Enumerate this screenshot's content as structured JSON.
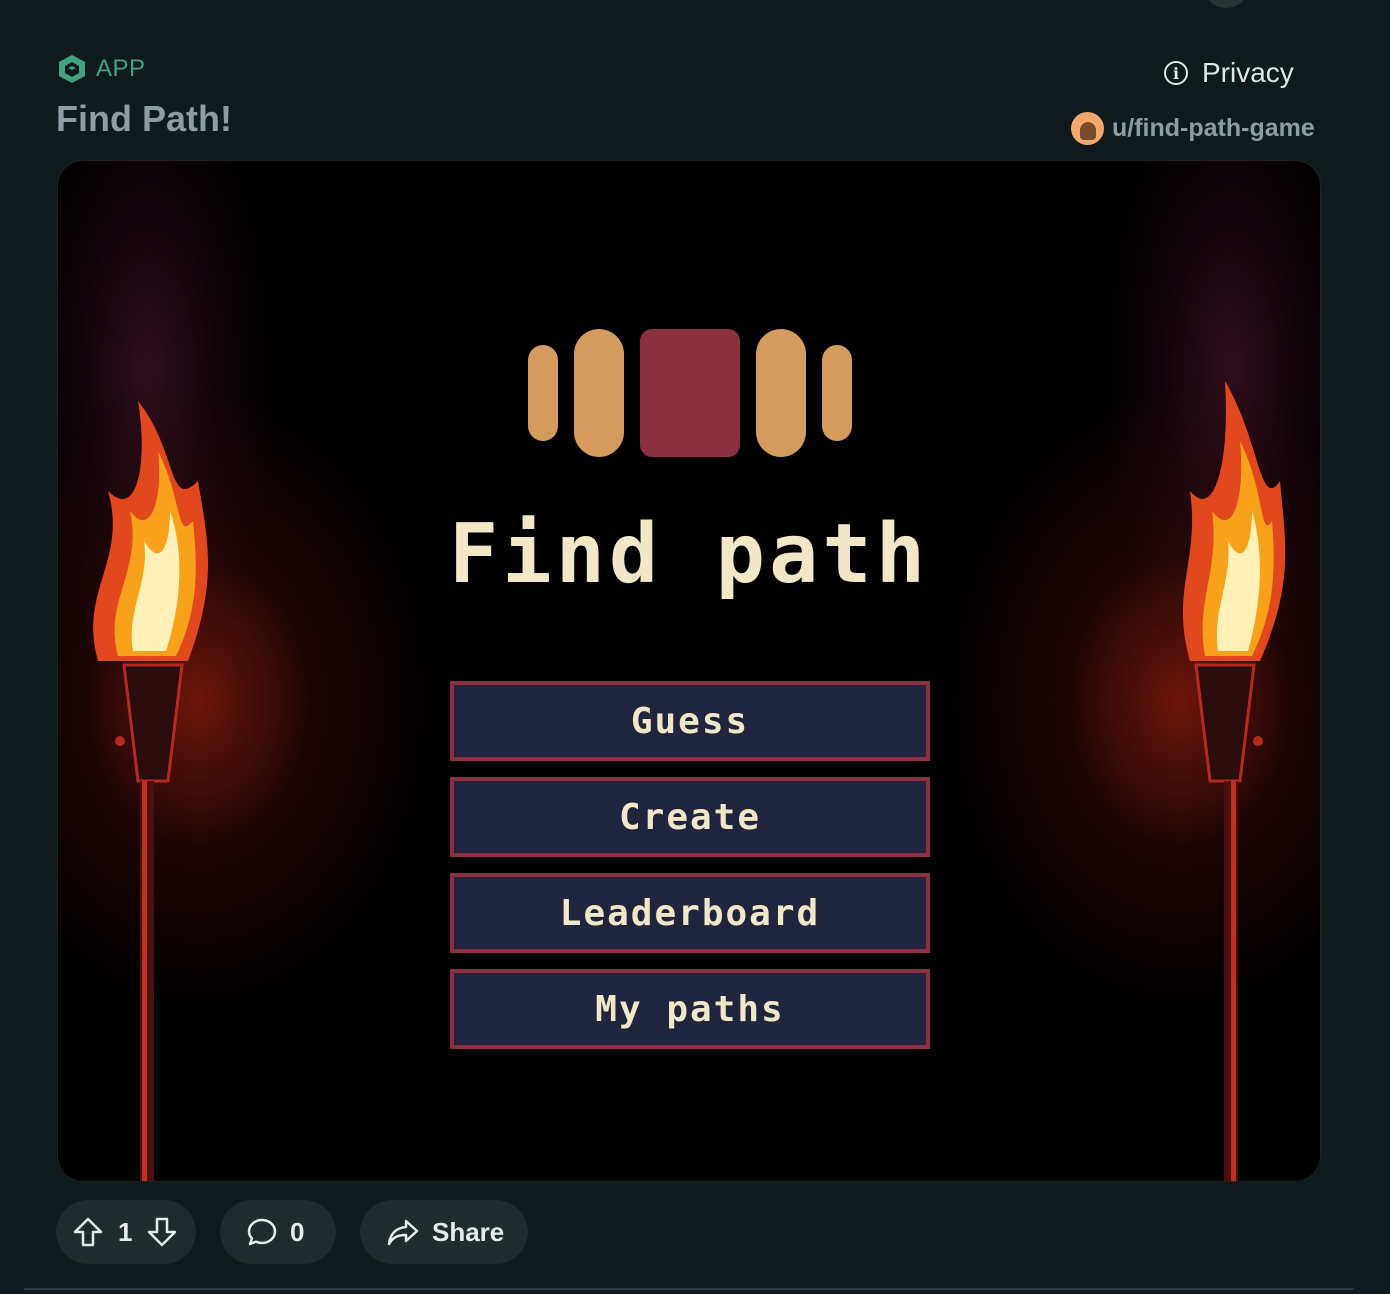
{
  "post": {
    "app_label": "APP",
    "title": "Find Path!",
    "privacy_label": "Privacy",
    "author": "u/find-path-game"
  },
  "game": {
    "title": "Find path",
    "menu": [
      {
        "label": "Guess"
      },
      {
        "label": "Create"
      },
      {
        "label": "Leaderboard"
      },
      {
        "label": "My paths"
      }
    ],
    "colors": {
      "logo_tan": "#d59a5e",
      "logo_maroon": "#8b3041",
      "button_bg": "#20253f",
      "button_border": "#8b3041",
      "text_cream": "#f2e8c8"
    }
  },
  "actions": {
    "upvotes": "1",
    "comments": "0",
    "share_label": "Share"
  },
  "icons": {
    "app": "app-hexagon-icon",
    "privacy": "info-circle-icon",
    "upvote": "upvote-arrow-icon",
    "downvote": "downvote-arrow-icon",
    "comment": "comment-bubble-icon",
    "share": "share-arrow-icon"
  }
}
